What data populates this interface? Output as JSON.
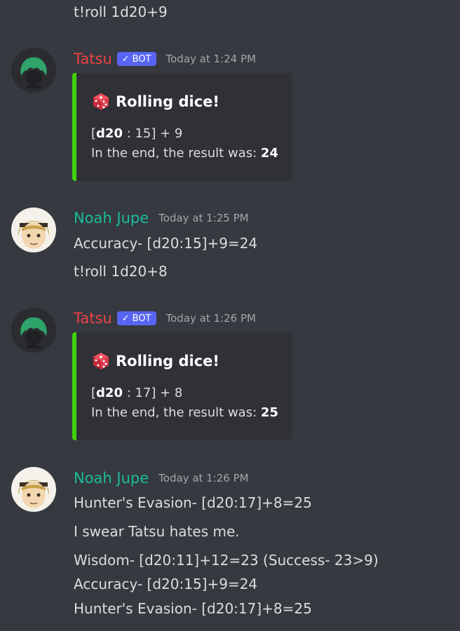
{
  "colors": {
    "background": "#36393f",
    "embed_bg": "#2f3136",
    "embed_accent": "#3fd20a",
    "bot_name": "#ed4245",
    "user_name": "#1abc9c",
    "bot_badge": "#5865f2"
  },
  "messages": {
    "top_line": "t!roll 1d20+9",
    "bot1": {
      "username": "Tatsu",
      "badge": "BOT",
      "badge_icon": "checkmark-icon",
      "timestamp": "Today at 1:24 PM",
      "embed": {
        "icon": "dice-icon",
        "title": "Rolling dice!",
        "roll_die": "d20",
        "roll_rest": " : 15] + 9",
        "result_prefix": "In the end, the result was: ",
        "result_value": "24"
      }
    },
    "user1": {
      "username": "Noah Jupe",
      "timestamp": "Today at 1:25 PM",
      "lines": [
        "Accuracy- [d20:15]+9=24",
        "t!roll 1d20+8"
      ]
    },
    "bot2": {
      "username": "Tatsu",
      "badge": "BOT",
      "badge_icon": "checkmark-icon",
      "timestamp": "Today at 1:26 PM",
      "embed": {
        "icon": "dice-icon",
        "title": "Rolling dice!",
        "roll_die": "d20",
        "roll_rest": " : 17] + 8",
        "result_prefix": "In the end, the result was: ",
        "result_value": "25"
      }
    },
    "user2": {
      "username": "Noah Jupe",
      "timestamp": "Today at 1:26 PM",
      "lines": [
        "Hunter's Evasion- [d20:17]+8=25",
        "I swear Tatsu hates me.",
        "Wisdom- [d20:11]+12=23 (Success- 23>9)",
        "Accuracy- [d20:15]+9=24",
        "Hunter's Evasion- [d20:17]+8=25"
      ]
    }
  }
}
